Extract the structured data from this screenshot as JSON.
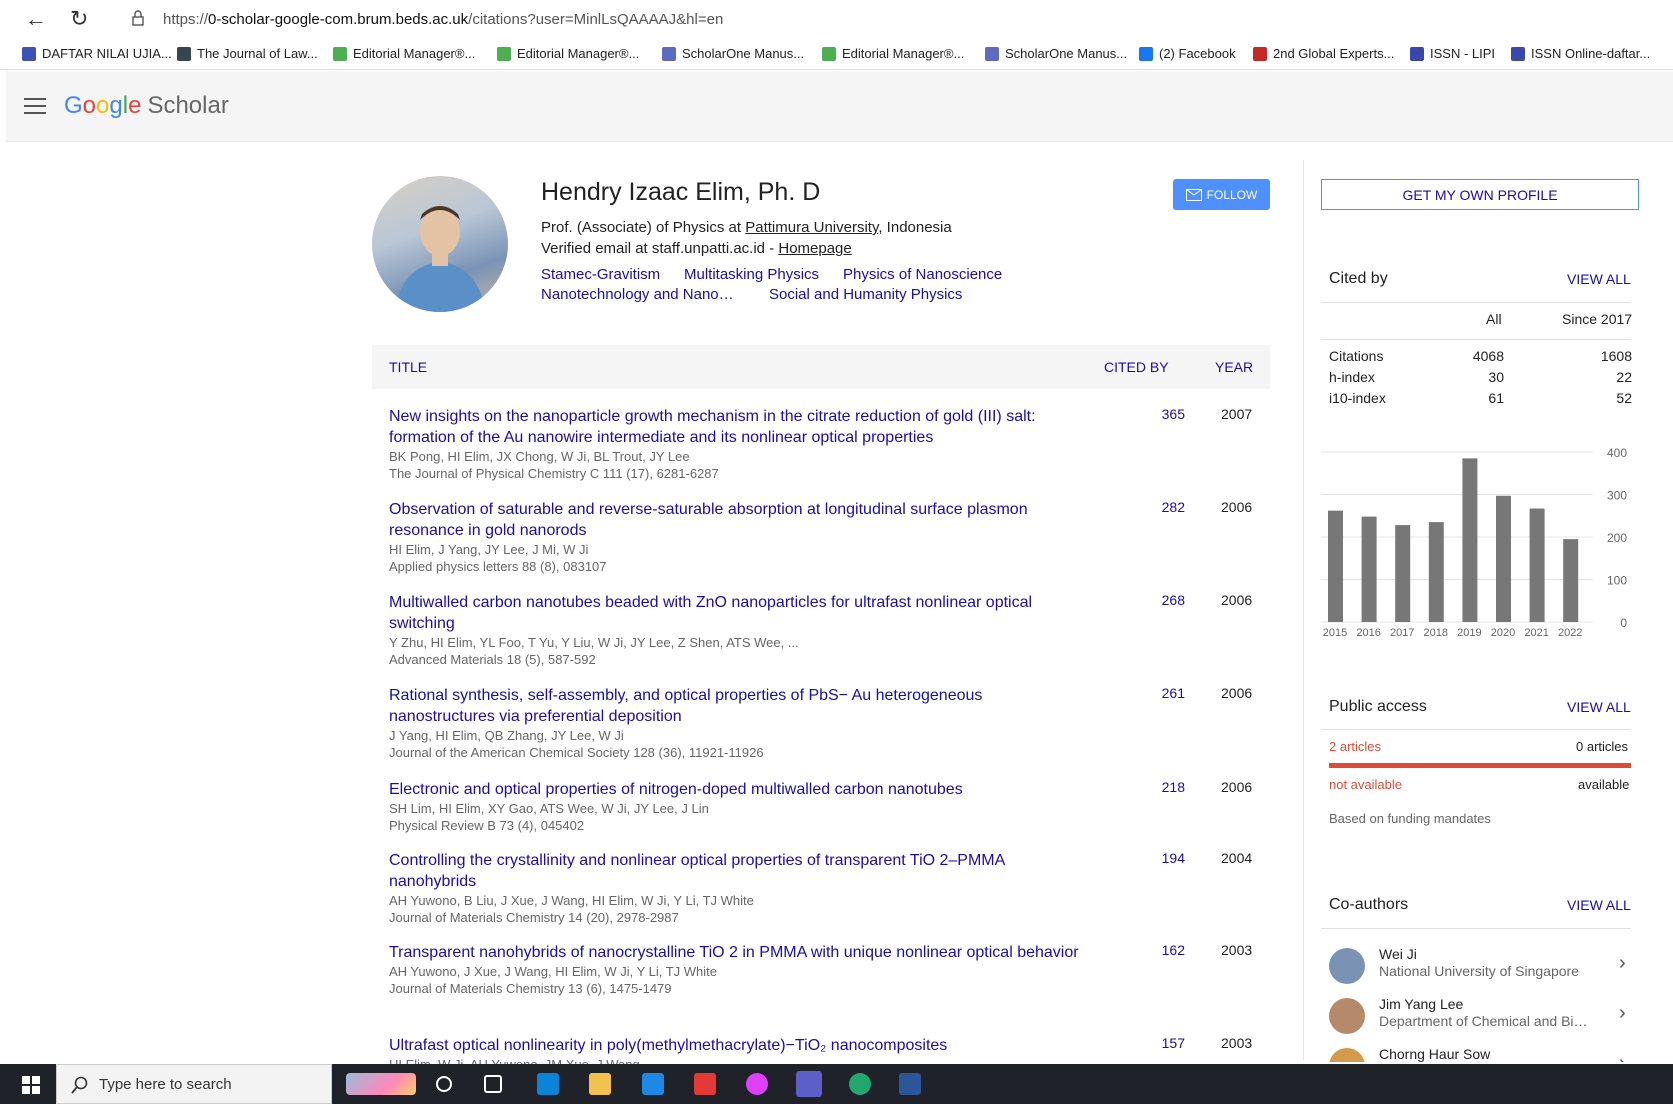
{
  "browser": {
    "url_prefix": "https://",
    "url_host": "0-scholar-google-com.brum.beds.ac.uk",
    "url_path": "/citations?user=MinlLsQAAAAJ&hl=en",
    "bookmarks": [
      {
        "label": "DAFTAR NILAI UJIA...",
        "color": "#3f51b5"
      },
      {
        "label": "The Journal of Law...",
        "color": "#37474f"
      },
      {
        "label": "Editorial Manager®...",
        "color": "#4caf50"
      },
      {
        "label": "Editorial Manager®...",
        "color": "#4caf50"
      },
      {
        "label": "ScholarOne Manus...",
        "color": "#5c6bc0"
      },
      {
        "label": "Editorial Manager®...",
        "color": "#4caf50"
      },
      {
        "label": "ScholarOne Manus...",
        "color": "#5c6bc0"
      },
      {
        "label": "(2) Facebook",
        "color": "#1877f2"
      },
      {
        "label": "2nd Global Experts...",
        "color": "#c62828"
      },
      {
        "label": "ISSN - LIPI",
        "color": "#3949ab"
      },
      {
        "label": "ISSN Online-daftar...",
        "color": "#3949ab"
      }
    ]
  },
  "header": {
    "logo_google": "Google",
    "logo_scholar": "Scholar"
  },
  "profile": {
    "name": "Hendry Izaac Elim, Ph. D",
    "affiliation_prefix": "Prof. (Associate) of Physics at ",
    "affiliation_link": "Pattimura University",
    "affiliation_suffix": ", Indonesia",
    "email_text": "Verified email at staff.unpatti.ac.id - ",
    "homepage_label": "Homepage",
    "interests": [
      "Stamec-Gravitism",
      "Multitasking Physics",
      "Physics of Nanoscience",
      "Nanotechnology and Nano…",
      "Social and Humanity Physics"
    ],
    "follow_label": "FOLLOW"
  },
  "table": {
    "headers": {
      "title": "TITLE",
      "cited_by": "CITED BY",
      "year": "YEAR"
    },
    "rows": [
      {
        "title": "New insights on the nanoparticle growth mechanism in the citrate reduction of gold (III) salt: formation of the Au nanowire intermediate and its nonlinear optical properties",
        "authors": "BK Pong, HI Elim, JX Chong, W Ji, BL Trout, JY Lee",
        "venue": "The Journal of Physical Chemistry C 111 (17), 6281-6287",
        "cited": "365",
        "year": "2007"
      },
      {
        "title": "Observation of saturable and reverse-saturable absorption at longitudinal surface plasmon resonance in gold nanorods",
        "authors": "HI Elim, J Yang, JY Lee, J Mi, W Ji",
        "venue": "Applied physics letters 88 (8), 083107",
        "cited": "282",
        "year": "2006"
      },
      {
        "title": "Multiwalled carbon nanotubes beaded with ZnO nanoparticles for ultrafast nonlinear optical switching",
        "authors": "Y Zhu, HI Elim, YL Foo, T Yu, Y Liu, W Ji, JY Lee, Z Shen, ATS Wee, ...",
        "venue": "Advanced Materials 18 (5), 587-592",
        "cited": "268",
        "year": "2006"
      },
      {
        "title": "Rational synthesis, self-assembly, and optical properties of PbS− Au heterogeneous nanostructures via preferential deposition",
        "authors": "J Yang, HI Elim, QB Zhang, JY Lee, W Ji",
        "venue": "Journal of the American Chemical Society 128 (36), 11921-11926",
        "cited": "261",
        "year": "2006"
      },
      {
        "title": "Electronic and optical properties of nitrogen-doped multiwalled carbon nanotubes",
        "authors": "SH Lim, HI Elim, XY Gao, ATS Wee, W Ji, JY Lee, J Lin",
        "venue": "Physical Review B 73 (4), 045402",
        "cited": "218",
        "year": "2006"
      },
      {
        "title": "Controlling the crystallinity and nonlinear optical properties of transparent TiO 2–PMMA nanohybrids",
        "authors": "AH Yuwono, B Liu, J Xue, J Wang, HI Elim, W Ji, Y Li, TJ White",
        "venue": "Journal of Materials Chemistry 14 (20), 2978-2987",
        "cited": "194",
        "year": "2004"
      },
      {
        "title": "Transparent nanohybrids of nanocrystalline TiO 2 in PMMA with unique nonlinear optical behavior",
        "authors": "AH Yuwono, J Xue, J Wang, HI Elim, W Ji, Y Li, TJ White",
        "venue": "Journal of Materials Chemistry 13 (6), 1475-1479",
        "cited": "162",
        "year": "2003"
      },
      {
        "title": "Ultrafast optical nonlinearity in poly(methylmethacrylate)−TiO₂ nanocomposites",
        "authors": "HI Elim, W Ji, AH Yuwono, JM Xue, J Wang",
        "venue": "",
        "cited": "157",
        "year": "2003"
      }
    ]
  },
  "sidebar": {
    "get_profile_label": "GET MY OWN PROFILE",
    "cited_by": {
      "title": "Cited by",
      "view_all": "VIEW ALL",
      "col_all": "All",
      "col_since": "Since 2017",
      "rows": [
        {
          "label": "Citations",
          "all": "4068",
          "since": "1608"
        },
        {
          "label": "h-index",
          "all": "30",
          "since": "22"
        },
        {
          "label": "i10-index",
          "all": "61",
          "since": "52"
        }
      ]
    },
    "public_access": {
      "title": "Public access",
      "view_all": "VIEW ALL",
      "left_count": "2 articles",
      "right_count": "0 articles",
      "left_status": "not available",
      "right_status": "available",
      "note": "Based on funding mandates",
      "accent": "#dd4b39"
    },
    "coauthors": {
      "title": "Co-authors",
      "view_all": "VIEW ALL",
      "items": [
        {
          "name": "Wei Ji",
          "affiliation": "National University of Singapore"
        },
        {
          "name": "Jim Yang Lee",
          "affiliation": "Department of Chemical and Biomolecular Engineering"
        },
        {
          "name": "Chorng Haur Sow",
          "affiliation": ""
        }
      ]
    }
  },
  "chart_data": {
    "type": "bar",
    "categories": [
      "2015",
      "2016",
      "2017",
      "2018",
      "2019",
      "2020",
      "2021",
      "2022"
    ],
    "values": [
      262,
      248,
      228,
      235,
      385,
      297,
      267,
      195
    ],
    "yticks": [
      0,
      100,
      200,
      300,
      400
    ],
    "ylim": [
      0,
      400
    ],
    "color": "#777777"
  },
  "taskbar": {
    "search_placeholder": "Type here to search"
  }
}
